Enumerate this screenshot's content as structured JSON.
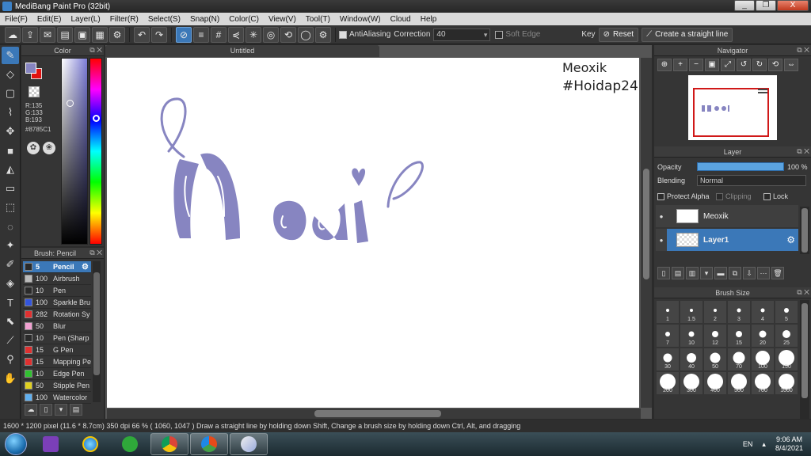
{
  "window": {
    "title": "MediBang Paint Pro (32bit)",
    "controls": [
      "_",
      "❐",
      "X"
    ]
  },
  "menu": [
    "File(F)",
    "Edit(E)",
    "Layer(L)",
    "Filter(R)",
    "Select(S)",
    "Snap(N)",
    "Color(C)",
    "View(V)",
    "Tool(T)",
    "Window(W)",
    "Cloud",
    "Help"
  ],
  "toolbar": {
    "antialias_label": "AntiAliasing",
    "correction_label": "Correction",
    "correction_value": "40",
    "softedge_label": "Soft Edge",
    "key_label": "Key",
    "reset_label": "Reset",
    "straight_line_label": "Create a straight line"
  },
  "color": {
    "title": "Color",
    "r": "R:135",
    "g": "G:133",
    "b": "B:193",
    "hex": "#8785C1",
    "foreground": "#8785C1",
    "background": "#E01010"
  },
  "brush_panel": {
    "title": "Brush: Pencil",
    "items": [
      {
        "size": "5",
        "name": "Pencil",
        "color": "#2a2a2a"
      },
      {
        "size": "100",
        "name": "Airbrush",
        "color": "#bbbbbb"
      },
      {
        "size": "10",
        "name": "Pen",
        "color": "#2a2a2a"
      },
      {
        "size": "100",
        "name": "Sparkle Bru",
        "color": "#3355dd"
      },
      {
        "size": "282",
        "name": "Rotation Sy",
        "color": "#e03030"
      },
      {
        "size": "50",
        "name": "Blur",
        "color": "#f0a0d0"
      },
      {
        "size": "10",
        "name": "Pen (Sharp",
        "color": "#2a2a2a"
      },
      {
        "size": "15",
        "name": "G Pen",
        "color": "#e03030"
      },
      {
        "size": "15",
        "name": "Mapping Pe",
        "color": "#e03030"
      },
      {
        "size": "10",
        "name": "Edge Pen",
        "color": "#30c030"
      },
      {
        "size": "50",
        "name": "Stipple Pen",
        "color": "#e0d020"
      },
      {
        "size": "100",
        "name": "Watercolor",
        "color": "#60b0f0"
      }
    ]
  },
  "canvas": {
    "tab_title": "Untitled",
    "watermark_line1": "Meoxik",
    "watermark_line2": "#Hoidap247"
  },
  "navigator": {
    "title": "Navigator"
  },
  "layer_panel": {
    "title": "Layer",
    "opacity_label": "Opacity",
    "opacity_value": "100 %",
    "opacity_fraction": 1.0,
    "blending_label": "Blending",
    "blending_value": "Normal",
    "protect_alpha_label": "Protect Alpha",
    "clipping_label": "Clipping",
    "lock_label": "Lock",
    "layers": [
      {
        "name": "Meoxik",
        "selected": false
      },
      {
        "name": "Layer1",
        "selected": true
      }
    ]
  },
  "brush_size": {
    "title": "Brush Size",
    "sizes": [
      "1",
      "1.5",
      "2",
      "3",
      "4",
      "5",
      "7",
      "10",
      "12",
      "15",
      "20",
      "25",
      "30",
      "40",
      "50",
      "70",
      "100",
      "150",
      "200",
      "300",
      "400",
      "500",
      "700",
      "1000"
    ]
  },
  "status": {
    "text": "1600 * 1200 pixel   (11.6 * 8.7cm)   350 dpi   66 %   ( 1060, 1047 )   Draw a straight line by holding down Shift, Change a brush size by holding down Ctrl, Alt, and dragging"
  },
  "taskbar": {
    "lang": "EN",
    "time": "9:06 AM",
    "date": "8/4/2021"
  }
}
